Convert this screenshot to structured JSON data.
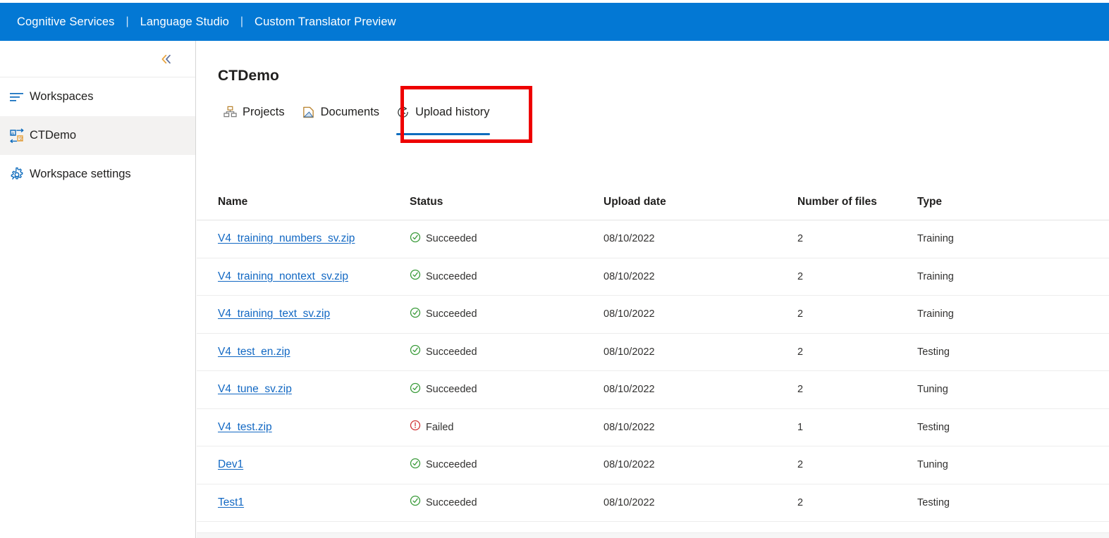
{
  "header": {
    "items": [
      {
        "label": "Cognitive Services",
        "icon": "none"
      },
      {
        "label": "Language Studio",
        "icon": "none"
      },
      {
        "label": "Custom Translator Preview",
        "icon": "none"
      }
    ],
    "separator": "|",
    "background_color": "#0378d4",
    "text_color": "#ffffff"
  },
  "sidebar": {
    "collapse_icon": "chevron-double-left-icon",
    "items": [
      {
        "label": "Workspaces",
        "icon": "workspaces-list-icon",
        "selected": false
      },
      {
        "label": "CTDemo",
        "icon": "translator-icon",
        "selected": true
      },
      {
        "label": "Workspace settings",
        "icon": "gear-icon",
        "selected": false
      }
    ]
  },
  "main": {
    "title": "CTDemo",
    "tabs": [
      {
        "label": "Projects",
        "icon": "projects-icon",
        "active": false
      },
      {
        "label": "Documents",
        "icon": "documents-icon",
        "active": false
      },
      {
        "label": "Upload history",
        "icon": "history-clock-icon",
        "active": true
      }
    ],
    "annotation": {
      "color": "#ee0000",
      "target_tab": "Upload history"
    },
    "table": {
      "columns": [
        "Name",
        "Status",
        "Upload date",
        "Number of files",
        "Type"
      ],
      "rows": [
        {
          "name": "V4_training_numbers_sv.zip",
          "status": "Succeeded",
          "status_icon": "check-circle-icon",
          "date": "08/10/2022",
          "files": "2",
          "type": "Training"
        },
        {
          "name": "V4_training_nontext_sv.zip",
          "status": "Succeeded",
          "status_icon": "check-circle-icon",
          "date": "08/10/2022",
          "files": "2",
          "type": "Training"
        },
        {
          "name": "V4_training_text_sv.zip",
          "status": "Succeeded",
          "status_icon": "check-circle-icon",
          "date": "08/10/2022",
          "files": "2",
          "type": "Training"
        },
        {
          "name": "V4_test_en.zip",
          "status": "Succeeded",
          "status_icon": "check-circle-icon",
          "date": "08/10/2022",
          "files": "2",
          "type": "Testing"
        },
        {
          "name": "V4_tune_sv.zip",
          "status": "Succeeded",
          "status_icon": "check-circle-icon",
          "date": "08/10/2022",
          "files": "2",
          "type": "Tuning"
        },
        {
          "name": "V4_test.zip",
          "status": "Failed",
          "status_icon": "error-circle-icon",
          "date": "08/10/2022",
          "files": "1",
          "type": "Testing"
        },
        {
          "name": "Dev1",
          "status": "Succeeded",
          "status_icon": "check-circle-icon",
          "date": "08/10/2022",
          "files": "2",
          "type": "Tuning"
        },
        {
          "name": "Test1",
          "status": "Succeeded",
          "status_icon": "check-circle-icon",
          "date": "08/10/2022",
          "files": "2",
          "type": "Testing"
        }
      ]
    }
  },
  "colors": {
    "accent": "#0378d4",
    "link": "#1268c3",
    "success": "#3a9b3a",
    "error": "#d13438",
    "tab_underline": "#0f6cbd",
    "selected_row": "#f3f2f1"
  }
}
